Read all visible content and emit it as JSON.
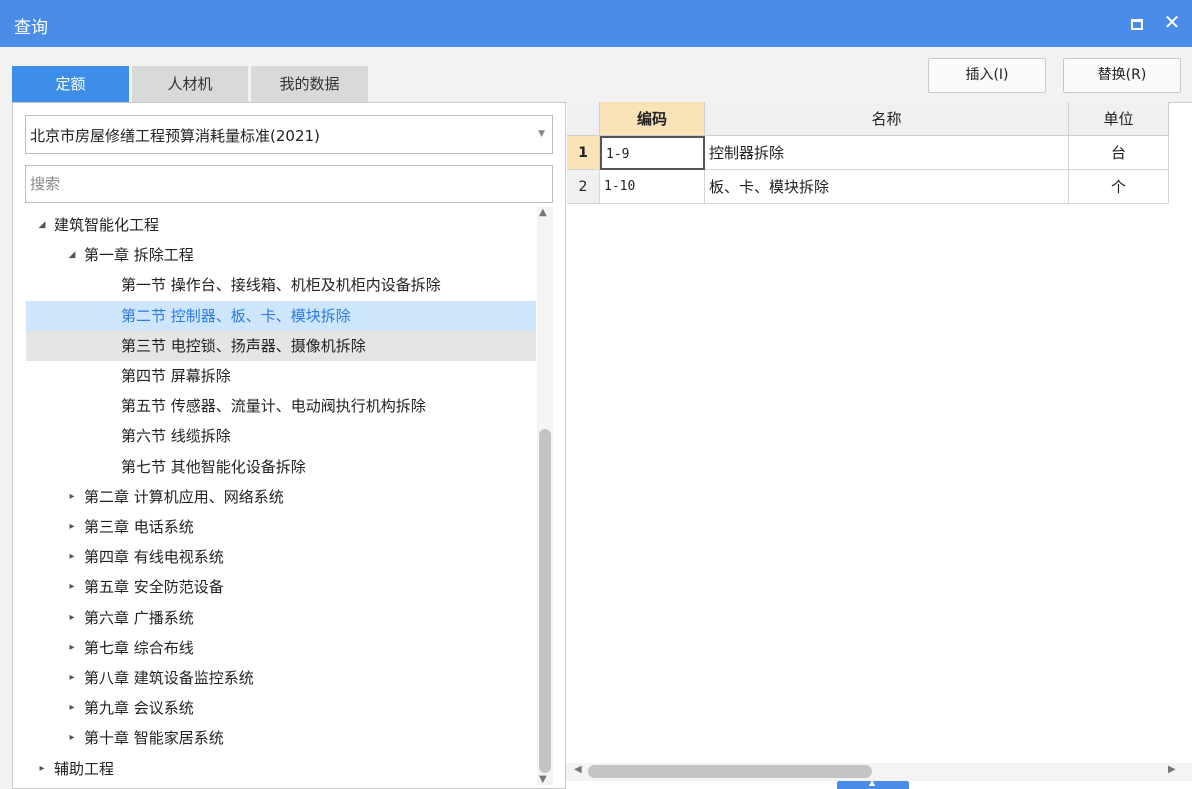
{
  "window": {
    "title": "查询"
  },
  "tabs": [
    {
      "label": "定额",
      "active": true
    },
    {
      "label": "人材机",
      "active": false
    },
    {
      "label": "我的数据",
      "active": false
    }
  ],
  "toolbar": {
    "insert_label": "插入(I)",
    "replace_label": "替换(R)"
  },
  "library": {
    "selected": "北京市房屋修缮工程预算消耗量标准(2021)"
  },
  "search": {
    "placeholder": "搜索",
    "value": ""
  },
  "tree": [
    {
      "label": "建筑智能化工程",
      "level": 0,
      "expanded": true
    },
    {
      "label": "第一章 拆除工程",
      "level": 1,
      "expanded": true
    },
    {
      "label": "第一节 操作台、接线箱、机柜及机柜内设备拆除",
      "level": 2
    },
    {
      "label": "第二节 控制器、板、卡、模块拆除",
      "level": 2,
      "selected": true
    },
    {
      "label": "第三节 电控锁、扬声器、摄像机拆除",
      "level": 2,
      "hover": true
    },
    {
      "label": "第四节 屏幕拆除",
      "level": 2
    },
    {
      "label": "第五节 传感器、流量计、电动阀执行机构拆除",
      "level": 2
    },
    {
      "label": "第六节 线缆拆除",
      "level": 2
    },
    {
      "label": "第七节 其他智能化设备拆除",
      "level": 2
    },
    {
      "label": "第二章 计算机应用、网络系统",
      "level": 1,
      "expanded": false
    },
    {
      "label": "第三章 电话系统",
      "level": 1,
      "expanded": false
    },
    {
      "label": "第四章 有线电视系统",
      "level": 1,
      "expanded": false
    },
    {
      "label": "第五章 安全防范设备",
      "level": 1,
      "expanded": false
    },
    {
      "label": "第六章 广播系统",
      "level": 1,
      "expanded": false
    },
    {
      "label": "第七章 综合布线",
      "level": 1,
      "expanded": false
    },
    {
      "label": "第八章 建筑设备监控系统",
      "level": 1,
      "expanded": false
    },
    {
      "label": "第九章 会议系统",
      "level": 1,
      "expanded": false
    },
    {
      "label": "第十章 智能家居系统",
      "level": 1,
      "expanded": false
    },
    {
      "label": "辅助工程",
      "level": 0,
      "expanded": false
    }
  ],
  "grid": {
    "columns": {
      "code": "编码",
      "name": "名称",
      "unit": "单位"
    },
    "rows": [
      {
        "num": "1",
        "code": "1-9",
        "name": "控制器拆除",
        "unit": "台"
      },
      {
        "num": "2",
        "code": "1-10",
        "name": "板、卡、模块拆除",
        "unit": "个"
      }
    ]
  },
  "icons": {
    "maximize": "maximize-icon",
    "close": "close-icon",
    "dropdown": "chevron-down-icon",
    "expanded": "triangle-down-icon",
    "collapsed": "triangle-right-icon"
  },
  "colors": {
    "titlebar": "#4a8de8",
    "active_tab": "#3c8ee8",
    "selected_row": "#cde6fb",
    "header_highlight": "#fbe3b8"
  }
}
